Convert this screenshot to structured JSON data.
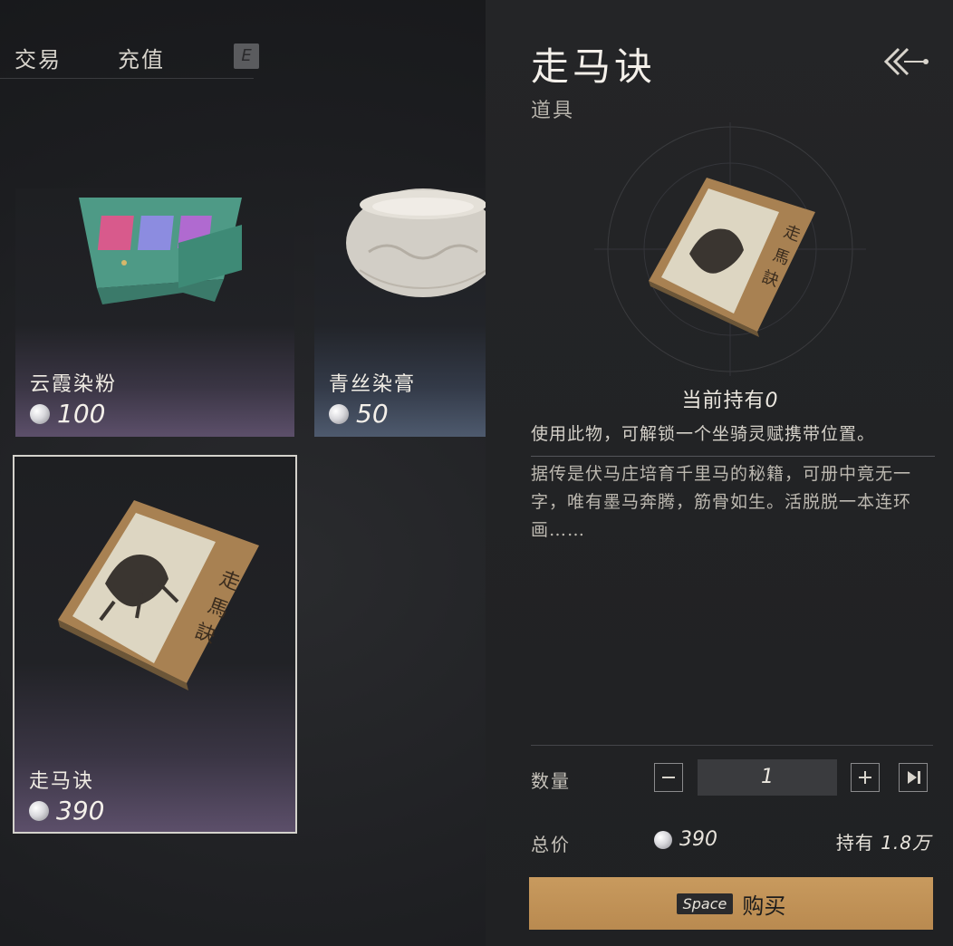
{
  "nav": {
    "tabs": [
      "交易",
      "充值"
    ],
    "key_hint": "E"
  },
  "items": [
    {
      "name": "云霞染粉",
      "price": "100"
    },
    {
      "name": "青丝染膏",
      "price": "50"
    },
    {
      "name": "走马诀",
      "price": "390"
    }
  ],
  "detail": {
    "title": "走马诀",
    "category": "道具",
    "owned_label": "当前持有",
    "owned_count": "0",
    "description_short": "使用此物，可解锁一个坐骑灵赋携带位置。",
    "description_long": "据传是伏马庄培育千里马的秘籍，可册中竟无一字，唯有墨马奔腾，筋骨如生。活脱脱一本连环画……",
    "quantity_label": "数量",
    "quantity_value": "1",
    "total_label": "总价",
    "total_value": "390",
    "holding_label": "持有",
    "holding_value": "1.8万",
    "buy_key": "Space",
    "buy_label": "购买"
  },
  "colors": {
    "accent": "#c89a5e",
    "card_purple": "#5c4f6a",
    "card_blue": "#4e5a6e"
  },
  "icons": [
    "pearl-currency-icon",
    "back-arrow-icon",
    "minus-icon",
    "plus-icon",
    "max-icon",
    "book-icon"
  ]
}
